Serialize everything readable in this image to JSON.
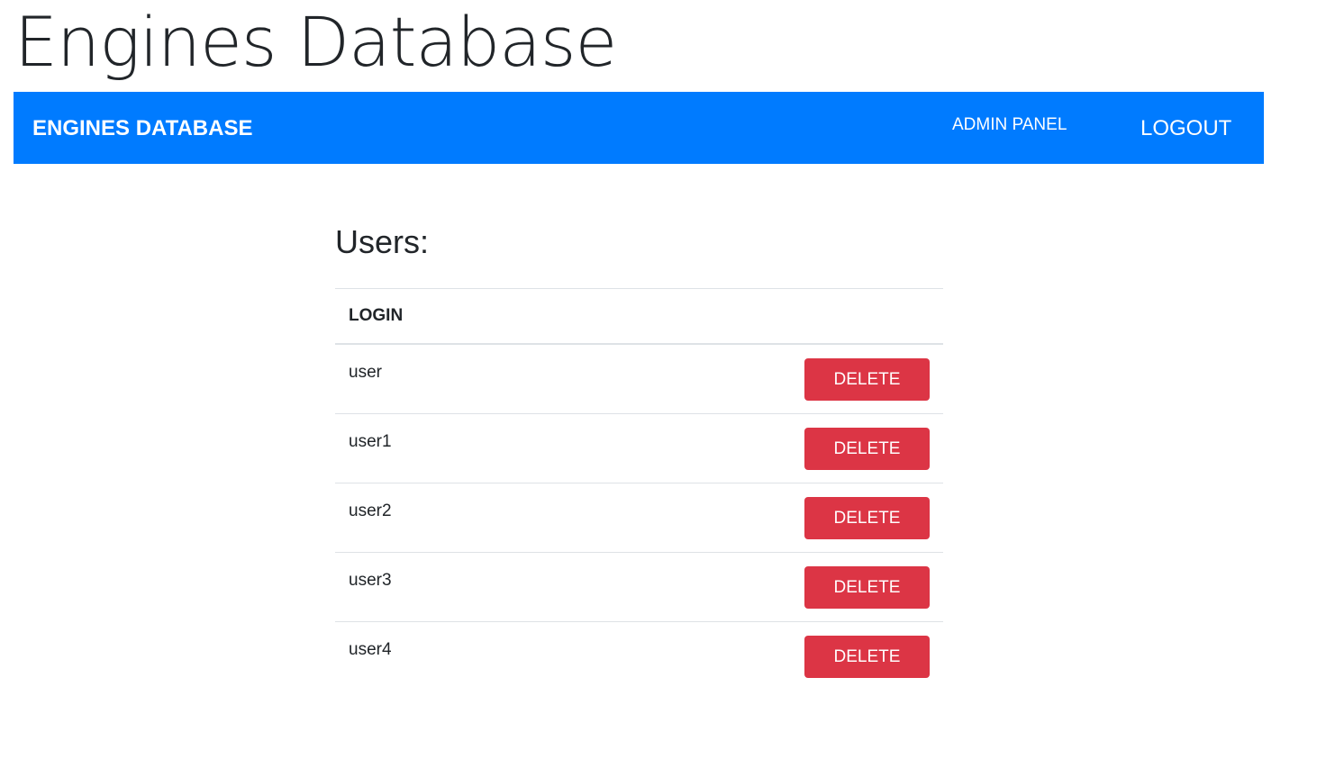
{
  "header": {
    "title": "Engines Database"
  },
  "navbar": {
    "brand": "ENGINES DATABASE",
    "admin_panel": "ADMIN PANEL",
    "logout": "LOGOUT",
    "color": "#007bff"
  },
  "main": {
    "section_title": "Users:",
    "table": {
      "columns": [
        "LOGIN"
      ],
      "rows": [
        {
          "login": "user",
          "action": "DELETE"
        },
        {
          "login": "user1",
          "action": "DELETE"
        },
        {
          "login": "user2",
          "action": "DELETE"
        },
        {
          "login": "user3",
          "action": "DELETE"
        },
        {
          "login": "user4",
          "action": "DELETE"
        }
      ]
    },
    "delete_color": "#dc3545"
  }
}
